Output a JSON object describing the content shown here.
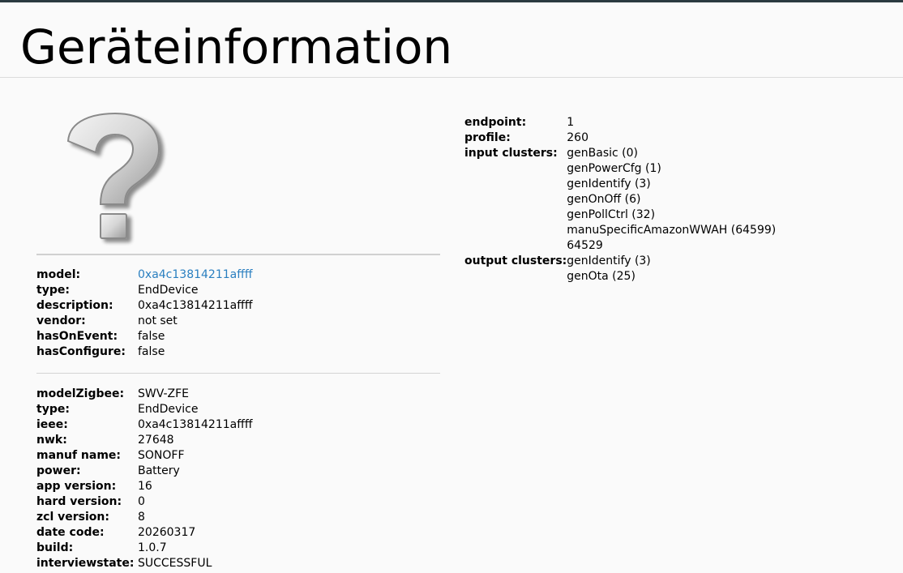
{
  "title": "Geräteinformation",
  "device": {
    "image_icon": "question-mark-icon",
    "model_label": "model:",
    "model_value": "0xa4c13814211affff",
    "type_label": "type:",
    "type_value": "EndDevice",
    "description_label": "description:",
    "description_value": "0xa4c13814211affff",
    "vendor_label": "vendor:",
    "vendor_value": "not set",
    "hasOnEvent_label": "hasOnEvent:",
    "hasOnEvent_value": "false",
    "hasConfigure_label": "hasConfigure:",
    "hasConfigure_value": "false"
  },
  "zigbee": {
    "rows": [
      {
        "label": "modelZigbee:",
        "value": "SWV-ZFE"
      },
      {
        "label": "type:",
        "value": "EndDevice"
      },
      {
        "label": "ieee:",
        "value": "0xa4c13814211affff"
      },
      {
        "label": "nwk:",
        "value": "27648"
      },
      {
        "label": "manuf name:",
        "value": "SONOFF"
      },
      {
        "label": "power:",
        "value": "Battery"
      },
      {
        "label": "app version:",
        "value": "16"
      },
      {
        "label": "hard version:",
        "value": "0"
      },
      {
        "label": "zcl version:",
        "value": "8"
      },
      {
        "label": "date code:",
        "value": "20260317"
      },
      {
        "label": "build:",
        "value": "1.0.7"
      },
      {
        "label": "interviewstate:",
        "value": "SUCCESSFUL"
      }
    ]
  },
  "endpoint": {
    "endpoint_label": "endpoint:",
    "endpoint_value": "1",
    "profile_label": "profile:",
    "profile_value": "260",
    "input_label": "input clusters:",
    "input_clusters": [
      "genBasic (0)",
      "genPowerCfg (1)",
      "genIdentify (3)",
      "genOnOff (6)",
      "genPollCtrl (32)",
      "manuSpecificAmazonWWAH (64599)",
      "64529"
    ],
    "output_label": "output clusters:",
    "output_clusters": [
      "genIdentify (3)",
      "genOta (25)"
    ]
  }
}
